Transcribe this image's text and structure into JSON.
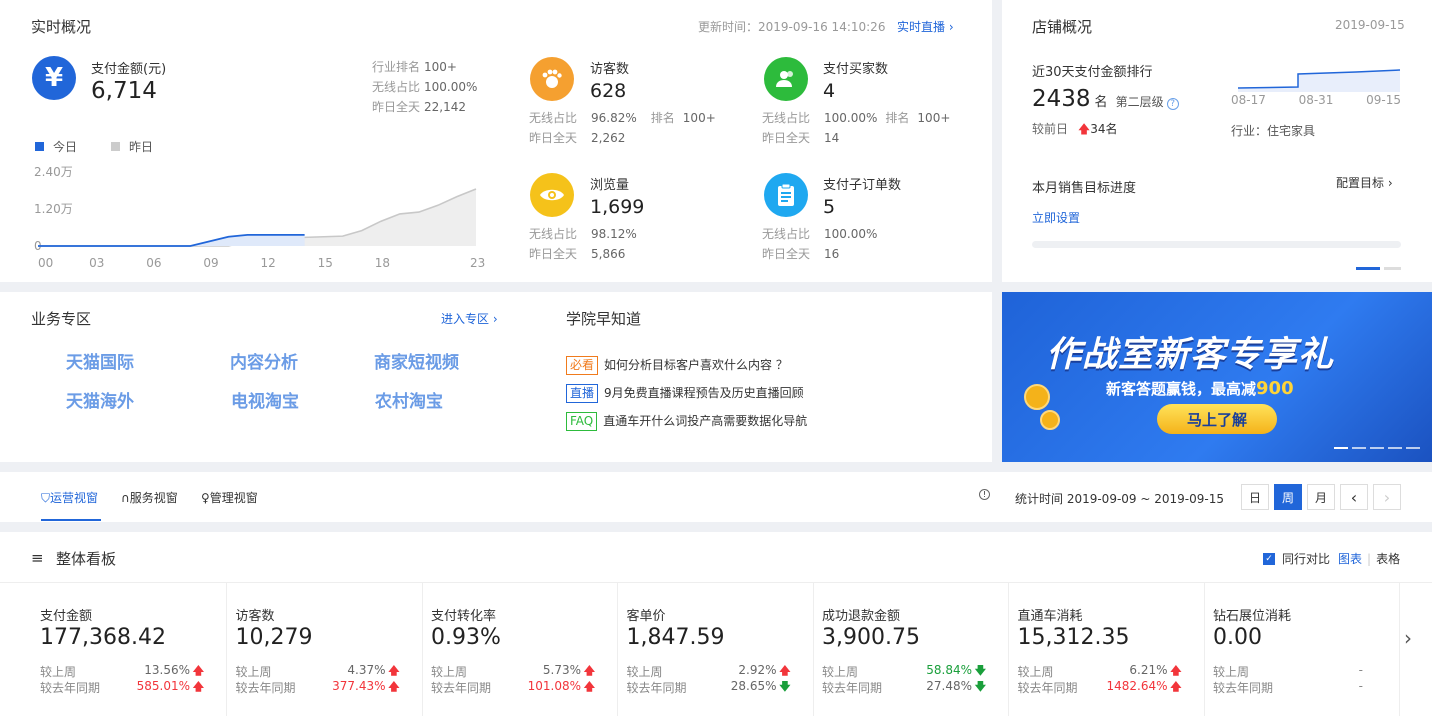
{
  "realtime": {
    "title": "实时概况",
    "update_time": "更新时间：2019-09-16 14:10:26",
    "live_link": "实时直播",
    "pay": {
      "label": "支付金额(元)",
      "value": "6,714",
      "icon": "yen-icon",
      "rank_label": "行业排名",
      "rank": "100+",
      "wireless_label": "无线占比",
      "wireless": "100.00%",
      "yesterday_label": "昨日全天",
      "yesterday": "22,142"
    },
    "legend_today": "今日",
    "legend_yesterday": "昨日",
    "ticks_y": [
      "2.40万",
      "1.20万",
      "0"
    ],
    "ticks_x": [
      "00",
      "03",
      "06",
      "09",
      "12",
      "15",
      "18",
      "23"
    ],
    "visitors": {
      "label": "访客数",
      "value": "628",
      "wl": "无线占比",
      "w": "96.82%",
      "rl": "排名",
      "r": "100+",
      "yl": "昨日全天",
      "y": "2,262",
      "color": "#f5a030"
    },
    "buyers": {
      "label": "支付买家数",
      "value": "4",
      "wl": "无线占比",
      "w": "100.00%",
      "rl": "排名",
      "r": "100+",
      "yl": "昨日全天",
      "y": "14",
      "color": "#2dbb3c"
    },
    "pv": {
      "label": "浏览量",
      "value": "1,699",
      "wl": "无线占比",
      "w": "98.12%",
      "yl": "昨日全天",
      "y": "5,866",
      "color": "#f5c21a"
    },
    "orders": {
      "label": "支付子订单数",
      "value": "5",
      "wl": "无线占比",
      "w": "100.00%",
      "yl": "昨日全天",
      "y": "16",
      "color": "#1fa8f0"
    }
  },
  "chart_data": {
    "type": "line",
    "title": "",
    "xlabel": "",
    "ylabel": "",
    "x": [
      0,
      3,
      6,
      9,
      12,
      15,
      18,
      23
    ],
    "ylim": [
      0,
      24000
    ],
    "y_ticks": [
      "0",
      "1.20万",
      "2.40万"
    ],
    "series": [
      {
        "name": "今日",
        "x": [
          0,
          1,
          2,
          3,
          4,
          5,
          6,
          7,
          8,
          9,
          10,
          11,
          12,
          13,
          14
        ],
        "values": [
          0,
          0,
          0,
          0,
          0,
          0,
          0,
          0,
          0,
          1500,
          3000,
          3600,
          3600,
          3600,
          3600
        ]
      },
      {
        "name": "昨日",
        "x": [
          0,
          2,
          4,
          6,
          8,
          9,
          10,
          11,
          12,
          13,
          14,
          15,
          16,
          17,
          18,
          19,
          20,
          21,
          22,
          23
        ],
        "values": [
          0,
          0,
          0,
          0,
          0,
          0,
          0,
          1500,
          1500,
          2800,
          2800,
          3000,
          3200,
          5000,
          8000,
          10400,
          11000,
          13200,
          16000,
          18500
        ]
      }
    ]
  },
  "shop": {
    "title": "店铺概况",
    "date": "2019-09-15",
    "rank_title": "近30天支付金额排行",
    "rank_value": "2438",
    "rank_unit": "名",
    "tier": "第二层级",
    "compare_label": "较前日",
    "compare_value": "34名",
    "x_ticks": [
      "08-17",
      "08-31",
      "09-15"
    ],
    "industry": "行业：住宅家具",
    "goal_title": "本月销售目标进度",
    "goal_link": "配置目标",
    "goal_set": "立即设置"
  },
  "business": {
    "title": "业务专区",
    "enter": "进入专区",
    "items": [
      "天猫国际",
      "内容分析",
      "商家短视频",
      "天猫海外",
      "电视淘宝",
      "农村淘宝"
    ]
  },
  "academy": {
    "title": "学院早知道",
    "items": [
      {
        "tag": "必看",
        "text": "如何分析目标客户喜欢什么内容 ？",
        "color": "#f07b1d"
      },
      {
        "tag": "直播",
        "text": "9月免费直播课程预告及历史直播回顾",
        "color": "#2166d9"
      },
      {
        "tag": "FAQ",
        "text": "直通车开什么词投产高需要数据化导航",
        "color": "#2dbb3c"
      }
    ]
  },
  "banner": {
    "title": "作战室新客专享礼",
    "subtitle_pre": "新客答题赢钱，最高减",
    "subtitle_num": "900",
    "button": "马上了解"
  },
  "tabs": {
    "items": [
      "运营视窗",
      "服务视窗",
      "管理视窗"
    ],
    "stat_label": "统计时间 2019-09-09 ~ 2019-09-15",
    "periods": [
      "日",
      "周",
      "月"
    ]
  },
  "board": {
    "title": "整体看板",
    "compare": "同行对比",
    "chart": "图表",
    "table": "表格",
    "metrics": [
      {
        "title": "支付金额",
        "value": "177,368.42",
        "l1": "较上周",
        "v1": "13.56%",
        "d1": "up",
        "l2": "较去年同期",
        "v2": "585.01%",
        "d2": "up"
      },
      {
        "title": "访客数",
        "value": "10,279",
        "l1": "较上周",
        "v1": "4.37%",
        "d1": "up",
        "l2": "较去年同期",
        "v2": "377.43%",
        "d2": "up"
      },
      {
        "title": "支付转化率",
        "value": "0.93%",
        "l1": "较上周",
        "v1": "5.73%",
        "d1": "up",
        "l2": "较去年同期",
        "v2": "101.08%",
        "d2": "up"
      },
      {
        "title": "客单价",
        "value": "1,847.59",
        "l1": "较上周",
        "v1": "2.92%",
        "d1": "up",
        "l2": "较去年同期",
        "v2": "28.65%",
        "d2": "down"
      },
      {
        "title": "成功退款金额",
        "value": "3,900.75",
        "l1": "较上周",
        "v1": "58.84%",
        "d1": "down",
        "l2": "较去年同期",
        "v2": "27.48%",
        "d2": "down"
      },
      {
        "title": "直通车消耗",
        "value": "15,312.35",
        "l1": "较上周",
        "v1": "6.21%",
        "d1": "up",
        "l2": "较去年同期",
        "v2": "1482.64%",
        "d2": "up"
      },
      {
        "title": "钻石展位消耗",
        "value": "0.00",
        "l1": "较上周",
        "v1": "-",
        "d1": "none",
        "l2": "较去年同期",
        "v2": "-",
        "d2": "none"
      }
    ]
  }
}
